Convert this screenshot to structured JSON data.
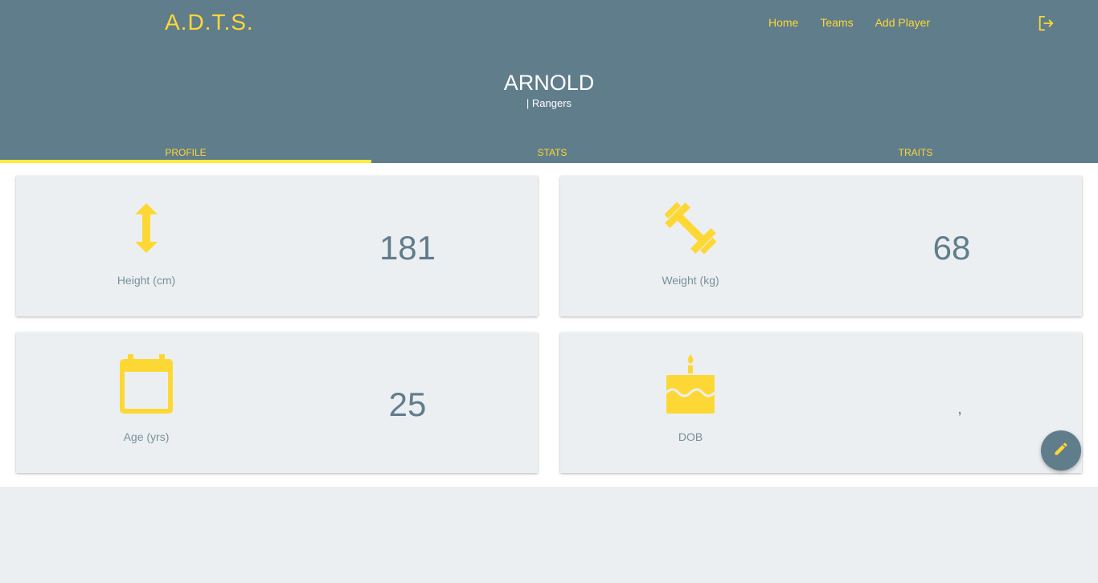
{
  "app": {
    "brand": "A.D.T.S."
  },
  "nav": {
    "items": [
      {
        "label": "Home"
      },
      {
        "label": "Teams"
      },
      {
        "label": "Add Player"
      }
    ],
    "logout_icon": "logout-icon"
  },
  "player": {
    "name": "ARNOLD",
    "team": "| Rangers"
  },
  "tabs": [
    {
      "label": "PROFILE",
      "active": true
    },
    {
      "label": "STATS",
      "active": false
    },
    {
      "label": "TRAITS",
      "active": false
    }
  ],
  "cards": [
    {
      "icon": "height-arrows-icon",
      "label": "Height (cm)",
      "value": "181"
    },
    {
      "icon": "dumbbell-icon",
      "label": "Weight (kg)",
      "value": "68"
    },
    {
      "icon": "calendar-icon",
      "label": "Age (yrs)",
      "value": "25"
    },
    {
      "icon": "cake-icon",
      "label": "DOB",
      "value": ","
    }
  ],
  "fab": {
    "icon": "edit-pencil-icon"
  },
  "colors": {
    "header": "#607d8b",
    "accent": "#fdd835",
    "card": "#eceff1",
    "value_text": "#607d8b",
    "label_text": "#78909c"
  }
}
